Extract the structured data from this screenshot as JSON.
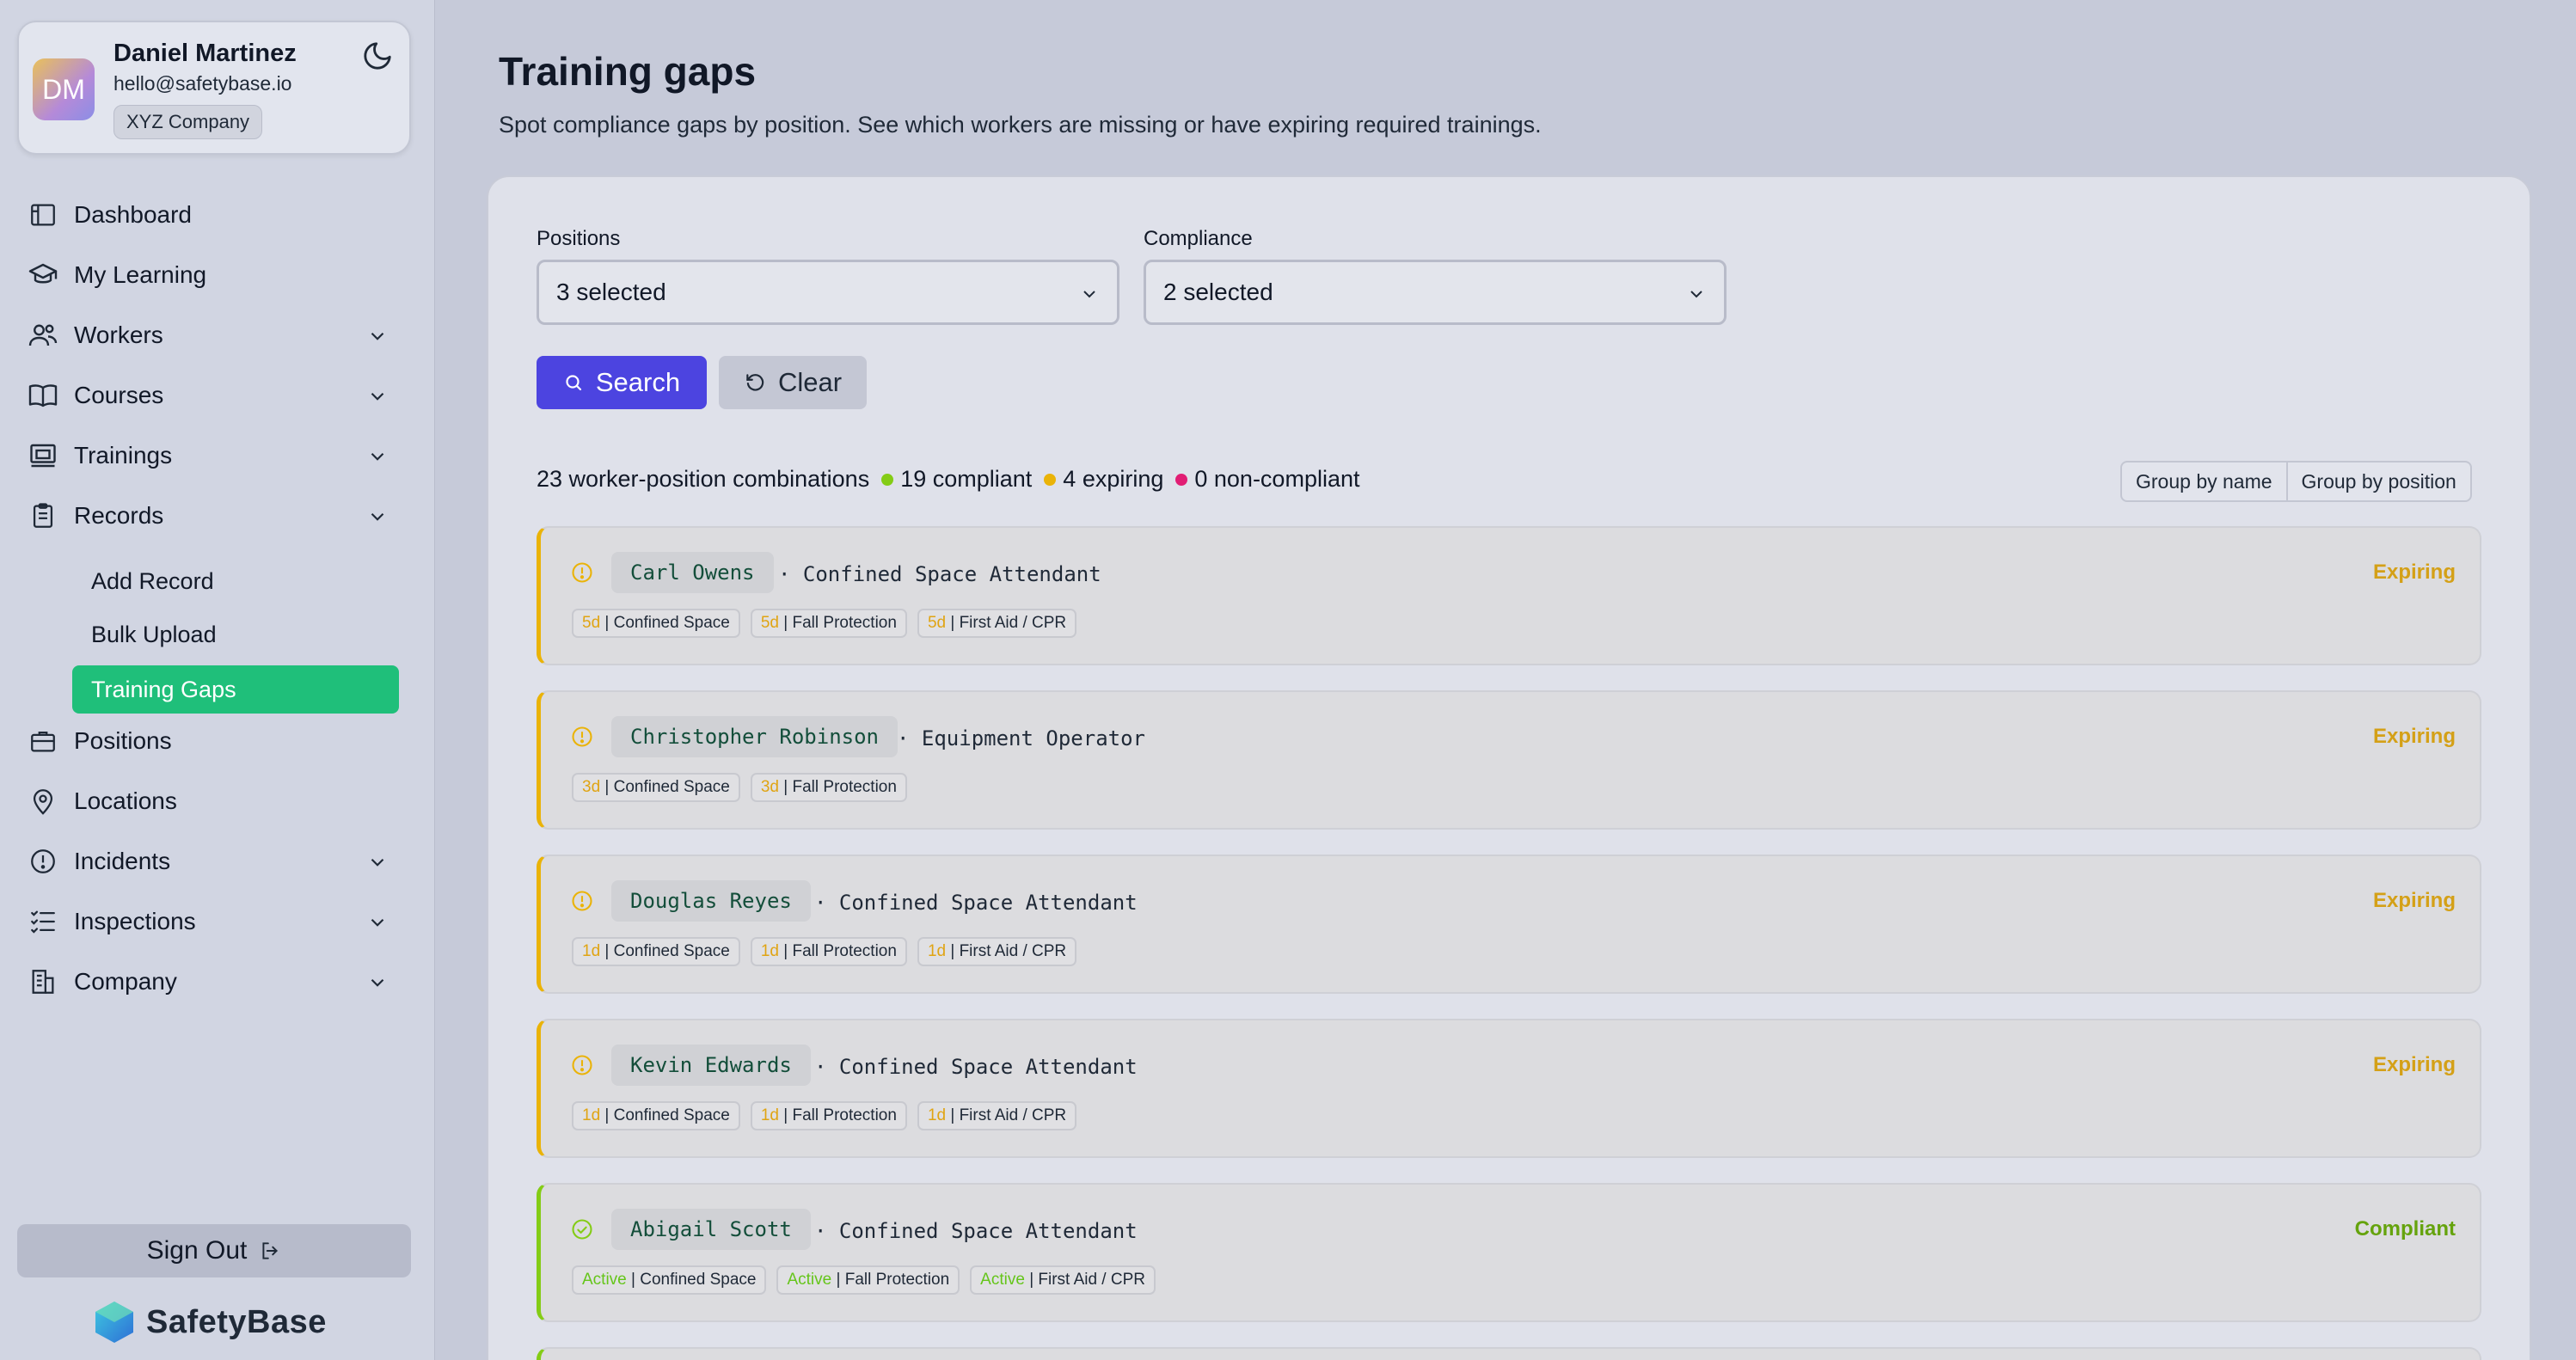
{
  "profile": {
    "initials": "DM",
    "name": "Daniel Martinez",
    "email": "hello@safetybase.io",
    "company": "XYZ Company"
  },
  "nav": {
    "dashboard": "Dashboard",
    "my_learning": "My Learning",
    "workers": "Workers",
    "courses": "Courses",
    "trainings": "Trainings",
    "records": "Records",
    "add_record": "Add Record",
    "bulk_upload": "Bulk Upload",
    "training_gaps": "Training Gaps",
    "positions": "Positions",
    "locations": "Locations",
    "incidents": "Incidents",
    "inspections": "Inspections",
    "company": "Company"
  },
  "sign_out": "Sign Out",
  "brand": "SafetyBase",
  "page": {
    "title": "Training gaps",
    "subtitle": "Spot compliance gaps by position. See which workers are missing or have expiring required trainings."
  },
  "filters": {
    "positions_label": "Positions",
    "positions_value": "3 selected",
    "compliance_label": "Compliance",
    "compliance_value": "2 selected",
    "search": "Search",
    "clear": "Clear"
  },
  "summary": {
    "total": "23 worker-position combinations",
    "compliant": "19 compliant",
    "expiring": "4 expiring",
    "noncompliant": "0 non-compliant"
  },
  "group": {
    "by_name": "Group by name",
    "by_position": "Group by position"
  },
  "colors": {
    "accent": "#4c44e0",
    "active_nav": "#1fbf7a",
    "expiring": "#eab308",
    "compliant": "#84cc16",
    "noncompliant": "#e11d74"
  },
  "rows": [
    {
      "name": "Carl Owens",
      "position": "· Confined Space Attendant",
      "status": "Expiring",
      "tags": [
        {
          "badge": "5d",
          "label": "| Confined Space"
        },
        {
          "badge": "5d",
          "label": "| Fall Protection"
        },
        {
          "badge": "5d",
          "label": "| First Aid / CPR"
        }
      ]
    },
    {
      "name": "Christopher Robinson",
      "position": "· Equipment Operator",
      "status": "Expiring",
      "tags": [
        {
          "badge": "3d",
          "label": "| Confined Space"
        },
        {
          "badge": "3d",
          "label": "| Fall Protection"
        }
      ]
    },
    {
      "name": "Douglas Reyes",
      "position": "· Confined Space Attendant",
      "status": "Expiring",
      "tags": [
        {
          "badge": "1d",
          "label": "| Confined Space"
        },
        {
          "badge": "1d",
          "label": "| Fall Protection"
        },
        {
          "badge": "1d",
          "label": "| First Aid / CPR"
        }
      ]
    },
    {
      "name": "Kevin Edwards",
      "position": "· Confined Space Attendant",
      "status": "Expiring",
      "tags": [
        {
          "badge": "1d",
          "label": "| Confined Space"
        },
        {
          "badge": "1d",
          "label": "| Fall Protection"
        },
        {
          "badge": "1d",
          "label": "| First Aid / CPR"
        }
      ]
    },
    {
      "name": "Abigail Scott",
      "position": "· Confined Space Attendant",
      "status": "Compliant",
      "tags": [
        {
          "badge": "Active",
          "label": "| Confined Space"
        },
        {
          "badge": "Active",
          "label": "| Fall Protection"
        },
        {
          "badge": "Active",
          "label": "| First Aid / CPR"
        }
      ]
    }
  ]
}
